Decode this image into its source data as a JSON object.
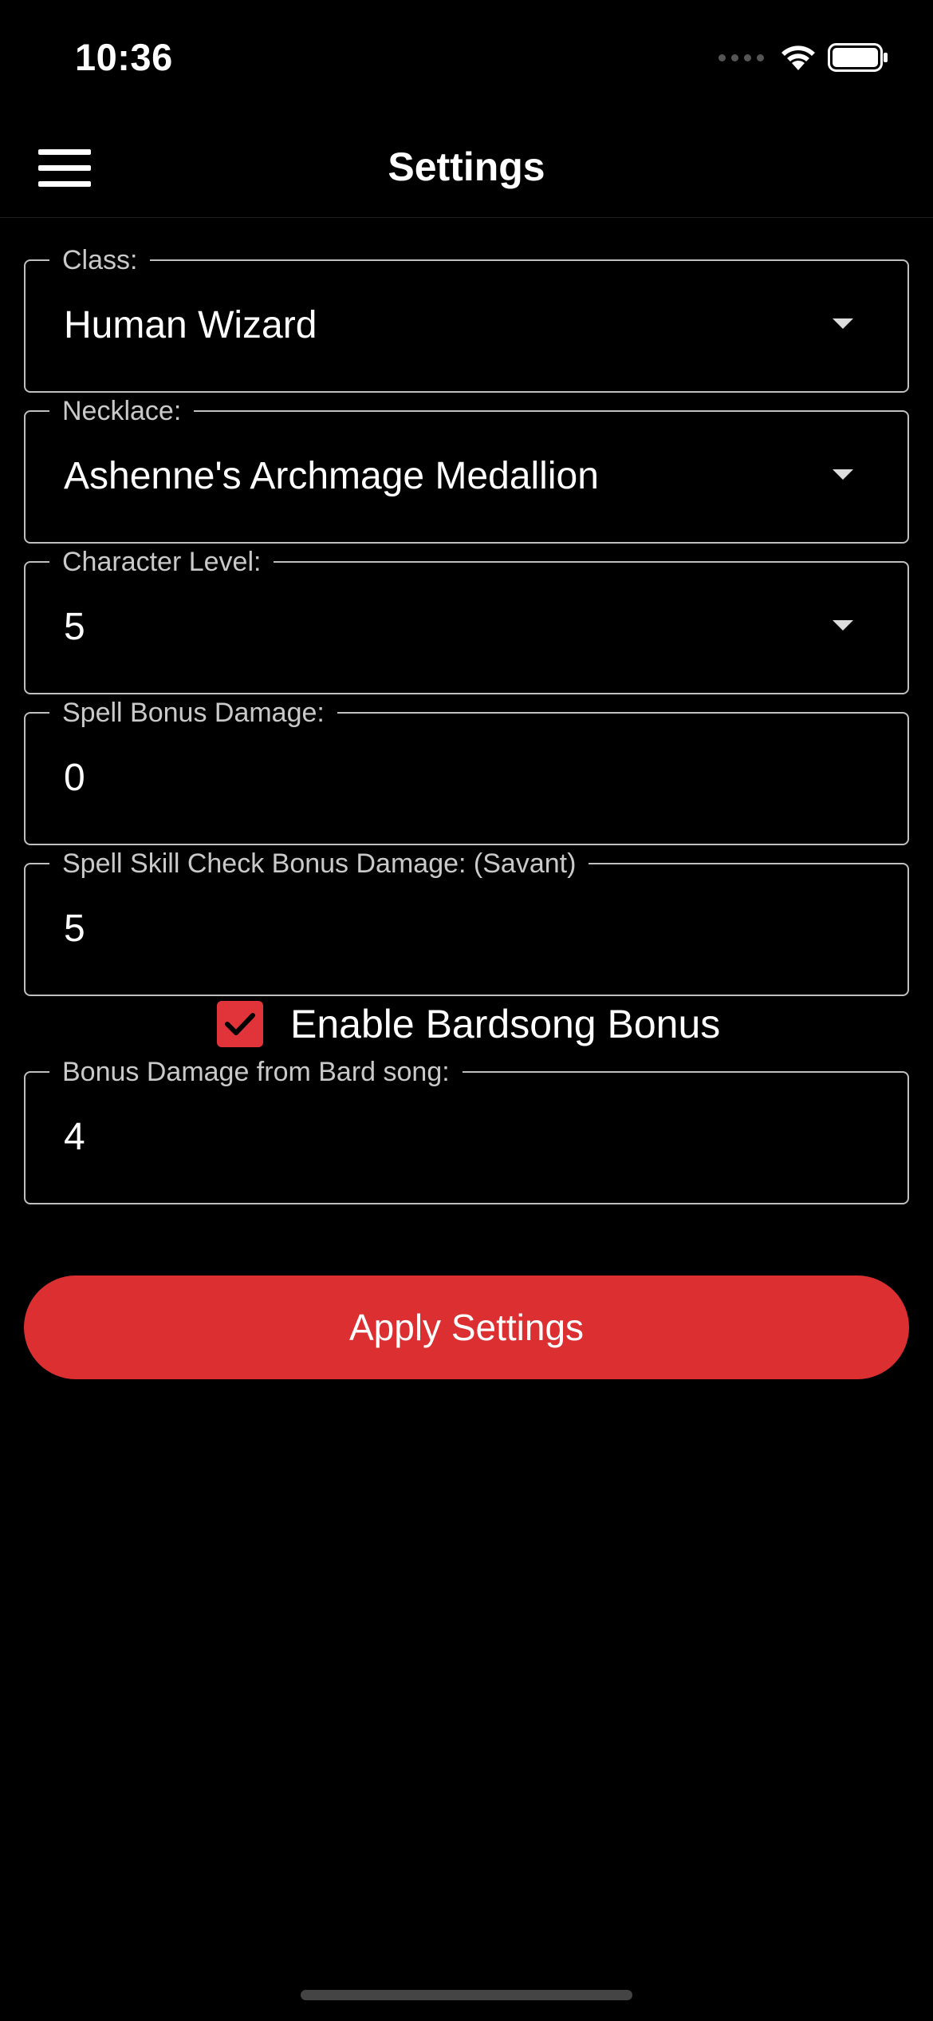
{
  "status_bar": {
    "time": "10:36"
  },
  "header": {
    "title": "Settings",
    "menu_icon": "hamburger-menu-icon"
  },
  "form": {
    "class": {
      "label": "Class:",
      "value": "Human Wizard"
    },
    "necklace": {
      "label": "Necklace:",
      "value": "Ashenne's Archmage Medallion"
    },
    "character_level": {
      "label": "Character Level:",
      "value": "5"
    },
    "spell_bonus_damage": {
      "label": "Spell Bonus Damage:",
      "value": "0"
    },
    "spell_skill_check_bonus": {
      "label": "Spell Skill Check Bonus Damage: (Savant)",
      "value": "5"
    },
    "bardsong": {
      "label": "Enable Bardsong Bonus",
      "checked": true
    },
    "bard_song_damage": {
      "label": "Bonus Damage from Bard song:",
      "value": "4"
    }
  },
  "apply_button": {
    "label": "Apply Settings"
  },
  "colors": {
    "accent": "#dc2f32",
    "background": "#000000",
    "border": "#bfbfbf"
  }
}
